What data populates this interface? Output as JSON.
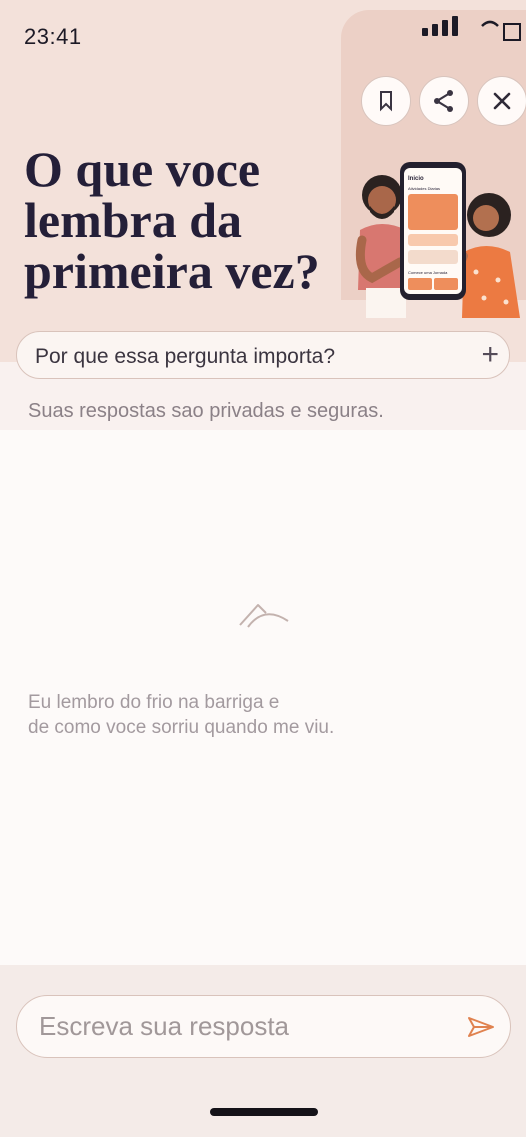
{
  "status_bar": {
    "time": "23:41"
  },
  "header": {
    "title": "O que voce lembra da primeira vez?",
    "actions": [
      {
        "name": "bookmark",
        "icon": "bookmark-icon"
      },
      {
        "name": "share",
        "icon": "share-icon"
      },
      {
        "name": "close",
        "icon": "close-icon"
      }
    ]
  },
  "illustration": {
    "phone_screen": {
      "title": "Inicio",
      "section": "Atividades Diarias",
      "footer": "Comece uma Jornada"
    }
  },
  "info": {
    "why_label": "Por que essa pergunta importa?",
    "expand_icon": "plus-icon",
    "privacy_note": "Suas respostas sao privadas e seguras."
  },
  "empty_state": {
    "icon": "mountain-icon",
    "line1": "Eu lembro do frio na barriga e",
    "line2": "de como voce sorriu quando me viu."
  },
  "composer": {
    "placeholder": "Escreva sua resposta",
    "value": "",
    "send_icon": "send-icon"
  },
  "colors": {
    "hero_bg": "#f3e1da",
    "accent": "#e0824f",
    "title": "#241f38"
  }
}
